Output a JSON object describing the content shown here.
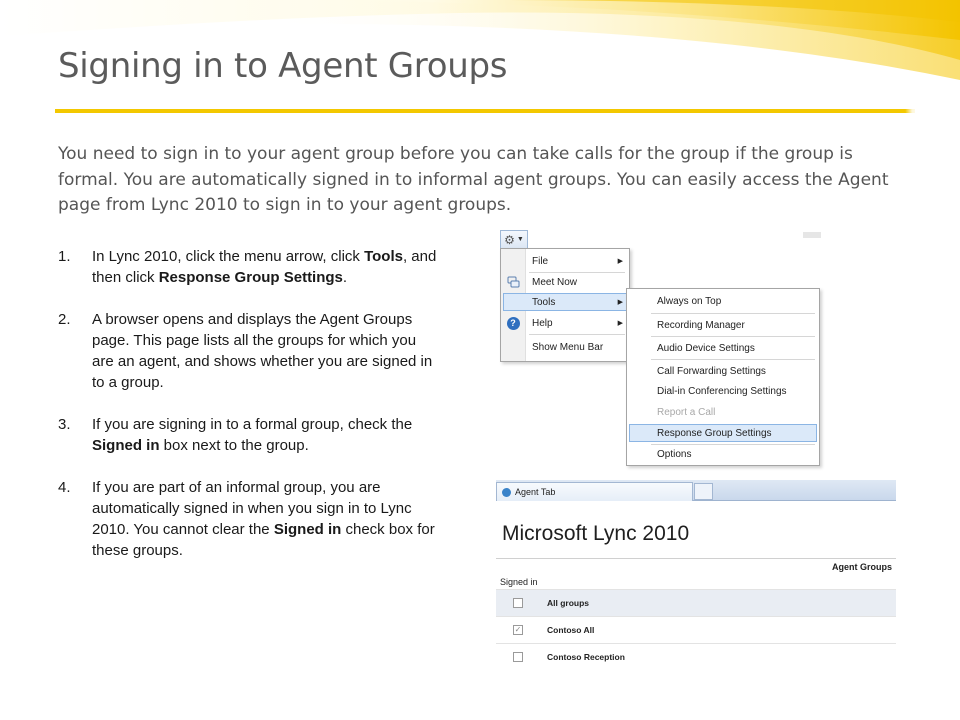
{
  "slide": {
    "title": "Signing in to Agent Groups",
    "intro": "You need to sign in to your agent group before you can take calls for the group if the group is formal. You are automatically signed in to informal agent groups. You can easily access the Agent page from Lync 2010 to sign in to your agent groups.",
    "accent_color": "#f3c800"
  },
  "steps": [
    {
      "num": "1.",
      "parts": [
        "In Lync 2010, click the menu arrow, click ",
        "Tools",
        ", and then click ",
        "Response Group Settings",
        "."
      ]
    },
    {
      "num": "2.",
      "parts": [
        "A browser opens and displays the Agent Groups page. This page lists all the groups for which you are an agent, and shows whether you are signed in to a group."
      ]
    },
    {
      "num": "3.",
      "parts": [
        "If you are signing in to a formal group, check the ",
        "Signed in",
        " box next to the group."
      ]
    },
    {
      "num": "4.",
      "parts": [
        "If you are part of an informal group, you are automatically signed in when you sign in to Lync 2010. You cannot clear the ",
        "Signed in",
        " check box for these groups."
      ]
    }
  ],
  "lync_menu": {
    "items": [
      {
        "label": "File",
        "arrow": "▶"
      },
      {
        "label": "Meet Now"
      },
      {
        "label": "Tools",
        "arrow": "▶"
      },
      {
        "label": "Help",
        "arrow": "▶"
      },
      {
        "label": "Show Menu Bar"
      }
    ],
    "tools_submenu": [
      {
        "label": "Always on Top"
      },
      {
        "label": "Recording Manager"
      },
      {
        "label": "Audio Device Settings"
      },
      {
        "label": "Call Forwarding Settings"
      },
      {
        "label": "Dial-in Conferencing Settings"
      },
      {
        "label": "Report a Call"
      },
      {
        "label": "Response Group Settings"
      },
      {
        "label": "Options"
      }
    ]
  },
  "agent_page": {
    "tab_label": "Agent Tab",
    "app_title": "Microsoft Lync 2010",
    "section_header": "Agent Groups",
    "column_header": "Signed in",
    "rows": [
      {
        "label": "All groups",
        "mark": ""
      },
      {
        "label": "Contoso All",
        "mark": "✓"
      },
      {
        "label": "Contoso Reception",
        "mark": ""
      }
    ]
  }
}
